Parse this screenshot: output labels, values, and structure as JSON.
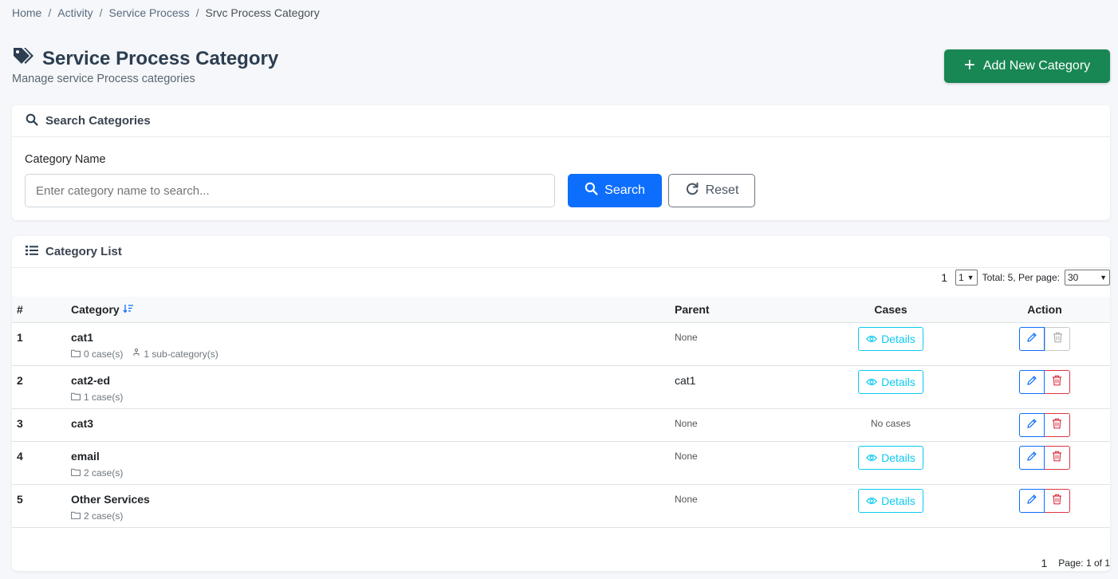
{
  "breadcrumb": [
    "Home",
    "Activity",
    "Service Process",
    "Srvc Process Category"
  ],
  "header": {
    "title": "Service Process Category",
    "subtitle": "Manage service Process categories",
    "add_label": "Add New Category"
  },
  "search": {
    "card_title": "Search Categories",
    "field_label": "Category Name",
    "placeholder": "Enter category name to search...",
    "value": "",
    "search_label": "Search",
    "reset_label": "Reset"
  },
  "list": {
    "card_title": "Category List",
    "pager_top": {
      "page": "1",
      "page_select": "1",
      "total_text": "Total: 5, Per page:",
      "per_page": "30"
    },
    "columns": [
      "#",
      "Category",
      "Parent",
      "Cases",
      "Action"
    ],
    "rows": [
      {
        "num": "1",
        "name": "cat1",
        "cases_meta": "0 case(s)",
        "sub_meta": "1 sub-category(s)",
        "parent": "None",
        "cases": "Details",
        "delete_disabled": true
      },
      {
        "num": "2",
        "name": "cat2-ed",
        "cases_meta": "1 case(s)",
        "sub_meta": "",
        "parent": "cat1",
        "cases": "Details",
        "delete_disabled": false
      },
      {
        "num": "3",
        "name": "cat3",
        "cases_meta": "",
        "sub_meta": "",
        "parent": "None",
        "cases": "No cases",
        "delete_disabled": false
      },
      {
        "num": "4",
        "name": "email",
        "cases_meta": "2 case(s)",
        "sub_meta": "",
        "parent": "None",
        "cases": "Details",
        "delete_disabled": false
      },
      {
        "num": "5",
        "name": "Other Services",
        "cases_meta": "2 case(s)",
        "sub_meta": "",
        "parent": "None",
        "cases": "Details",
        "delete_disabled": false
      }
    ],
    "pager_bottom": {
      "page": "1",
      "page_text": "Page: 1 of 1"
    }
  },
  "colors": {
    "primary": "#0d6efd",
    "success": "#198754",
    "info": "#0dcaf0",
    "danger": "#dc3545"
  }
}
